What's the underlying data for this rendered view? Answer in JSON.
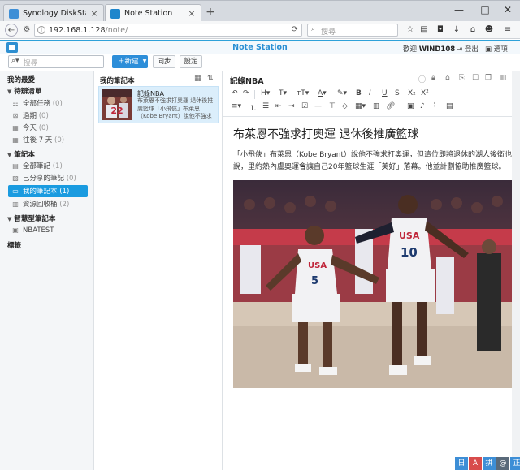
{
  "browser": {
    "tabs": [
      {
        "title": "Synology DiskStation - ...",
        "active": false
      },
      {
        "title": "Note Station",
        "active": true
      }
    ],
    "new_tab": "+",
    "window_controls": {
      "minimize": "—",
      "maximize": "□",
      "close": "✕"
    },
    "address": {
      "host": "192.168.1.128",
      "path": "/note/"
    },
    "search_placeholder": "搜尋"
  },
  "app": {
    "title": "Note Station",
    "welcome_label": "歡迎",
    "username": "WIND108",
    "logout": "登出",
    "options": "選項",
    "search_placeholder": "搜尋",
    "new_button": "新建",
    "sync_button": "同步",
    "settings_button": "設定"
  },
  "sidebar": {
    "favorites": "我的最愛",
    "todo_group": "待辦清單",
    "todo_items": [
      {
        "label": "全部任務",
        "count": "(0)"
      },
      {
        "label": "過期",
        "count": "(0)"
      },
      {
        "label": "今天",
        "count": "(0)"
      },
      {
        "label": "往後 7 天",
        "count": "(0)"
      }
    ],
    "notebook_group": "筆記本",
    "notebook_items": [
      {
        "label": "全部筆記",
        "count": "(1)"
      },
      {
        "label": "已分享的筆記",
        "count": "(0)"
      },
      {
        "label": "我的筆記本",
        "count": "(1)"
      },
      {
        "label": "資源回收桶",
        "count": "(2)"
      }
    ],
    "smart_group": "智慧型筆記本",
    "smart_items": [
      {
        "label": "NBATEST"
      }
    ],
    "tags": "標籤"
  },
  "list": {
    "title": "我的筆記本",
    "note": {
      "title": "記錄NBA",
      "snippet": "布萊恩不強求打奧運 退休後推廣籃球「小飛俠」布萊恩（Kobe Bryant）說他不強求打奧運，但這"
    }
  },
  "editor": {
    "title": "記錄NBA",
    "heading": "布萊恩不強求打奧運 退休後推廣籃球",
    "paragraph": "「小飛俠」布萊恩（Kobe Bryant）說他不強求打奧運，但這位即將退休的湖人後衛也說，里約熱內盧奧運會讓自己20年籃球生涯「美好」落幕。他並計劃協助推廣籃球。",
    "photo_jersey_left": "5",
    "photo_jersey_right": "10",
    "photo_team": "USA",
    "thumb_number": "22"
  },
  "ime": [
    "日",
    "A",
    "拼",
    "@",
    "正"
  ]
}
